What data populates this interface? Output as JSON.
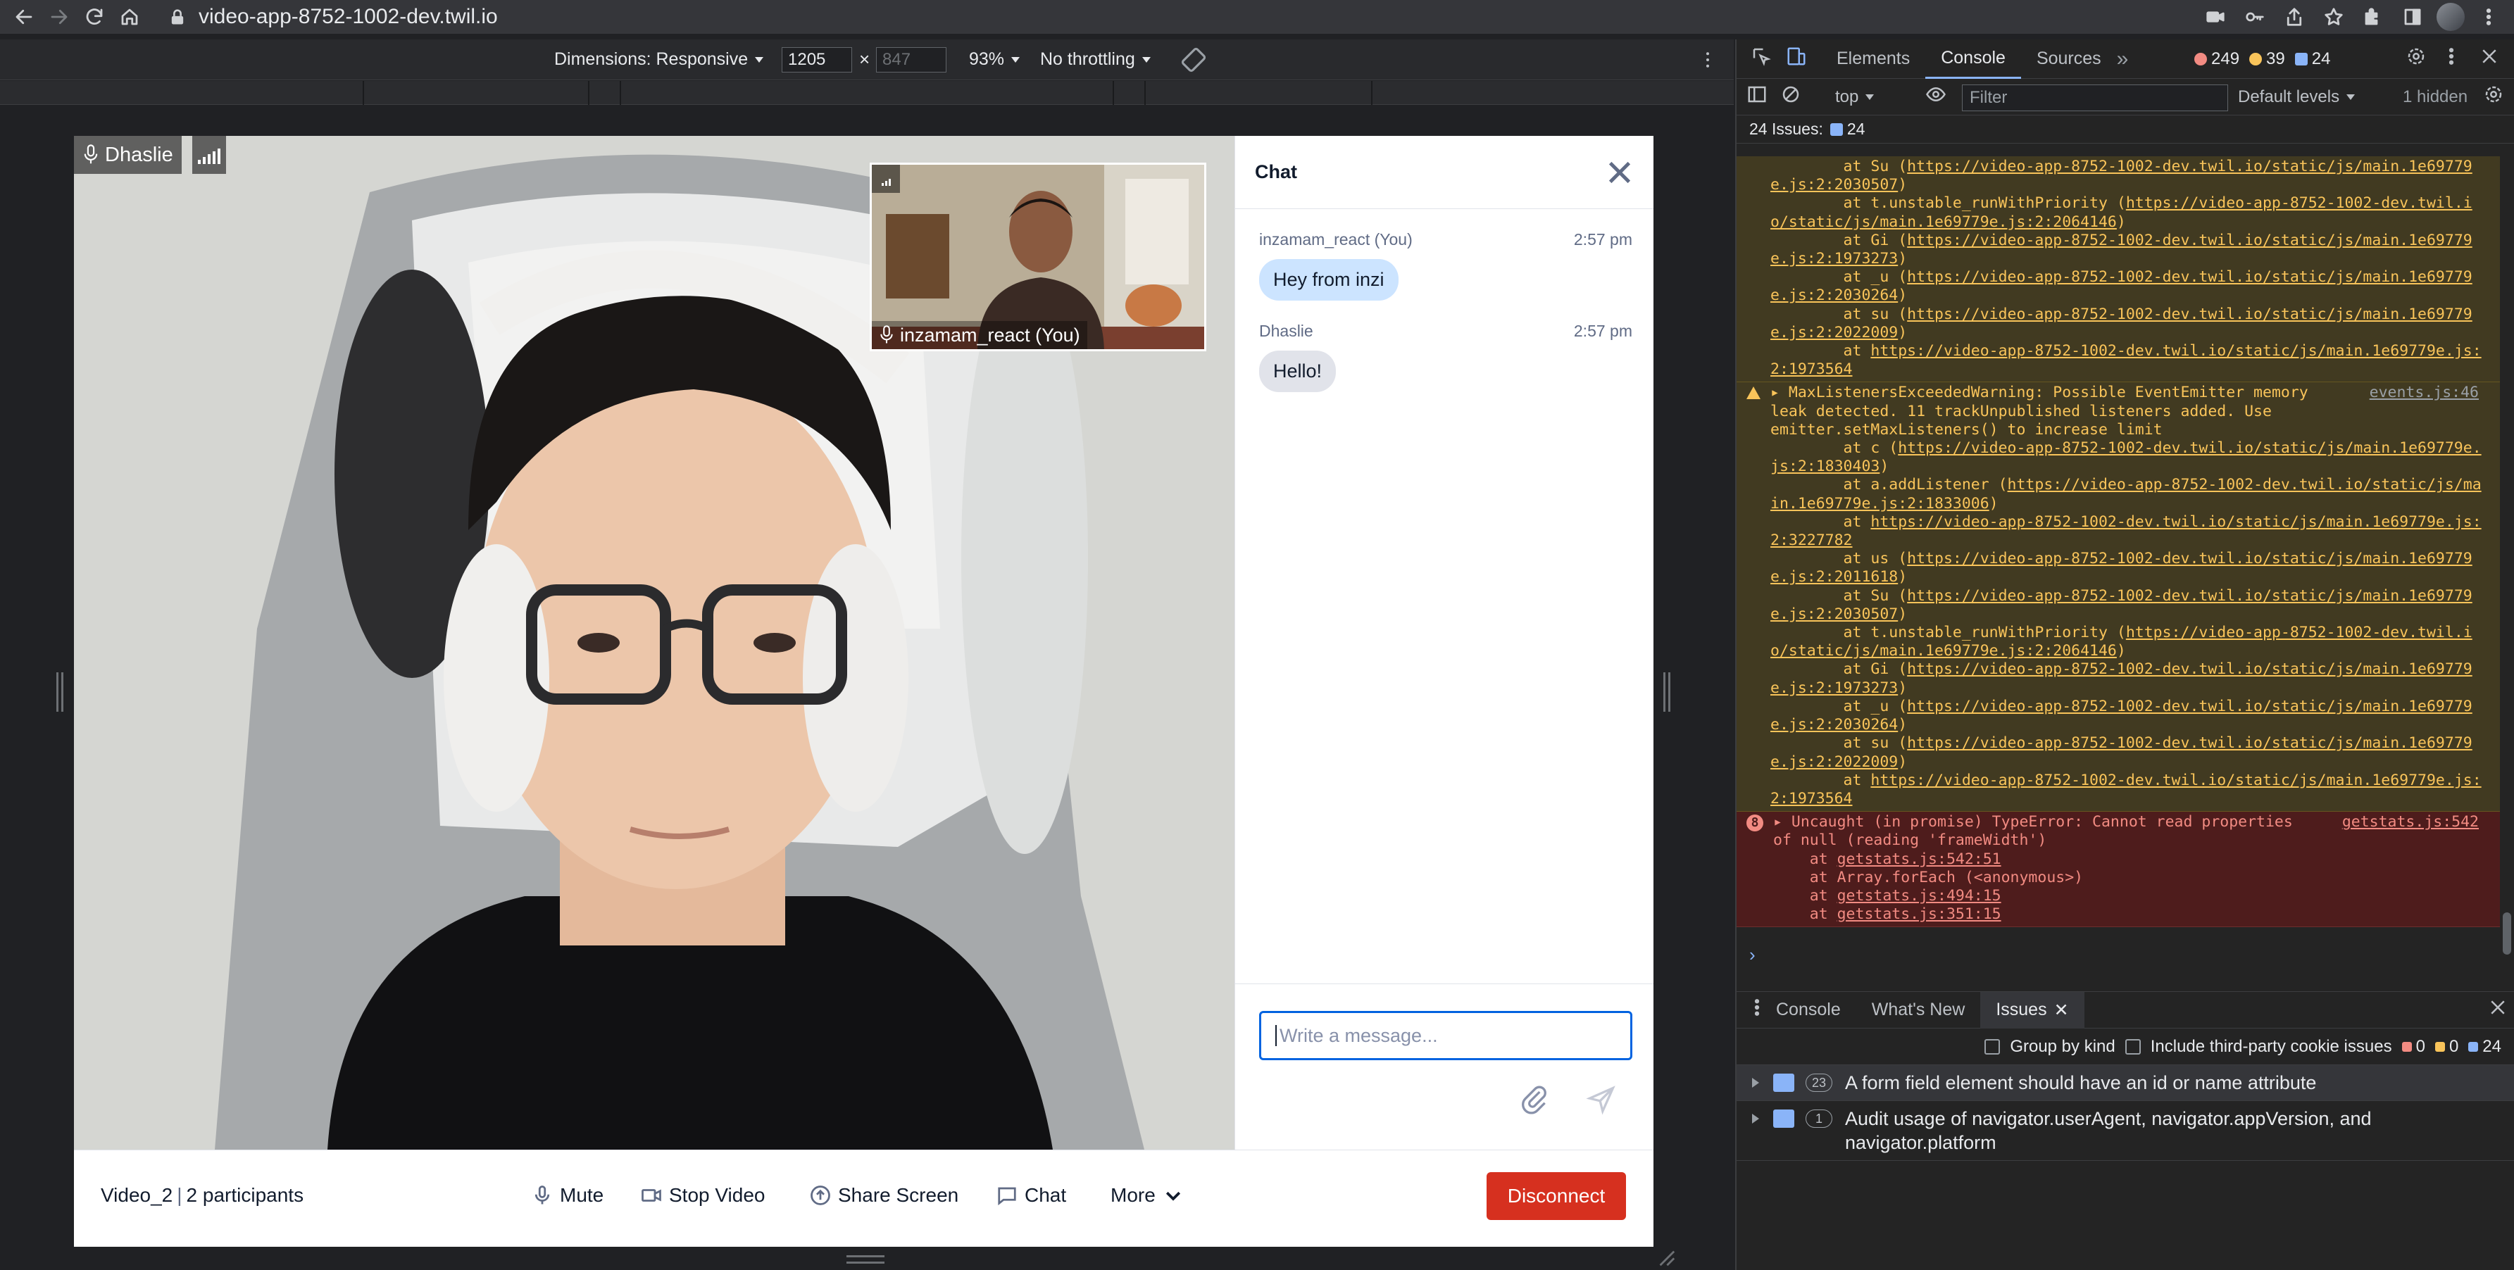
{
  "browser": {
    "url": "video-app-8752-1002-dev.twil.io"
  },
  "device_toolbar": {
    "dimensions_label": "Dimensions: Responsive",
    "width": "1205",
    "height": "847",
    "zoom": "93%",
    "throttling": "No throttling"
  },
  "video": {
    "main_participant": "Dhaslie",
    "local_participant": "inzamam_react (You)"
  },
  "chat": {
    "title": "Chat",
    "messages": [
      {
        "author": "inzamam_react (You)",
        "time": "2:57 pm",
        "text": "Hey from inzi"
      },
      {
        "author": "Dhaslie",
        "time": "2:57 pm",
        "text": "Hello!"
      }
    ],
    "input_placeholder": "Write a message..."
  },
  "menu_bar": {
    "room_name": "Video_2",
    "participants": "2 participants",
    "mute": "Mute",
    "stop_video": "Stop Video",
    "share_screen": "Share Screen",
    "chat": "Chat",
    "more": "More",
    "disconnect": "Disconnect"
  },
  "devtools": {
    "tabs": [
      "Elements",
      "Console",
      "Sources"
    ],
    "errors": "249",
    "warnings": "39",
    "issues_count": "24",
    "context": "top",
    "filter_placeholder": "Filter",
    "levels": "Default levels",
    "hidden": "1 hidden",
    "issues_line_label": "24 Issues:",
    "issues_line_count": "24",
    "warning_text": "MaxListenersExceededWarning: Possible EventEmitter memory\nleak detected. 11 trackUnpublished listeners added. Use\nemitter.setMaxListeners() to increase limit",
    "warning_source": "events.js:46",
    "error_count": "8",
    "error_text": "Uncaught (in promise) TypeError: Cannot read properties\nof null (reading 'frameWidth')",
    "error_source": "getstats.js:542",
    "drawer_tabs": [
      "Console",
      "What's New",
      "Issues"
    ],
    "group_by_kind": "Group by kind",
    "third_party": "Include third-party cookie issues",
    "issue_counts": [
      "0",
      "0",
      "24"
    ],
    "issues": [
      {
        "count": "23",
        "text": "A form field element should have an id or name attribute"
      },
      {
        "count": "1",
        "text": "Audit usage of navigator.userAgent, navigator.appVersion, and navigator.platform"
      }
    ]
  },
  "colors": {
    "disconnect": "#d6301f",
    "chat_bubble_mine": "#cce4ff",
    "chat_bubble_theirs": "#e1e3ea",
    "focus": "#0263e0",
    "warning_bg": "#413a21",
    "error_bg": "#4e1c1c"
  }
}
